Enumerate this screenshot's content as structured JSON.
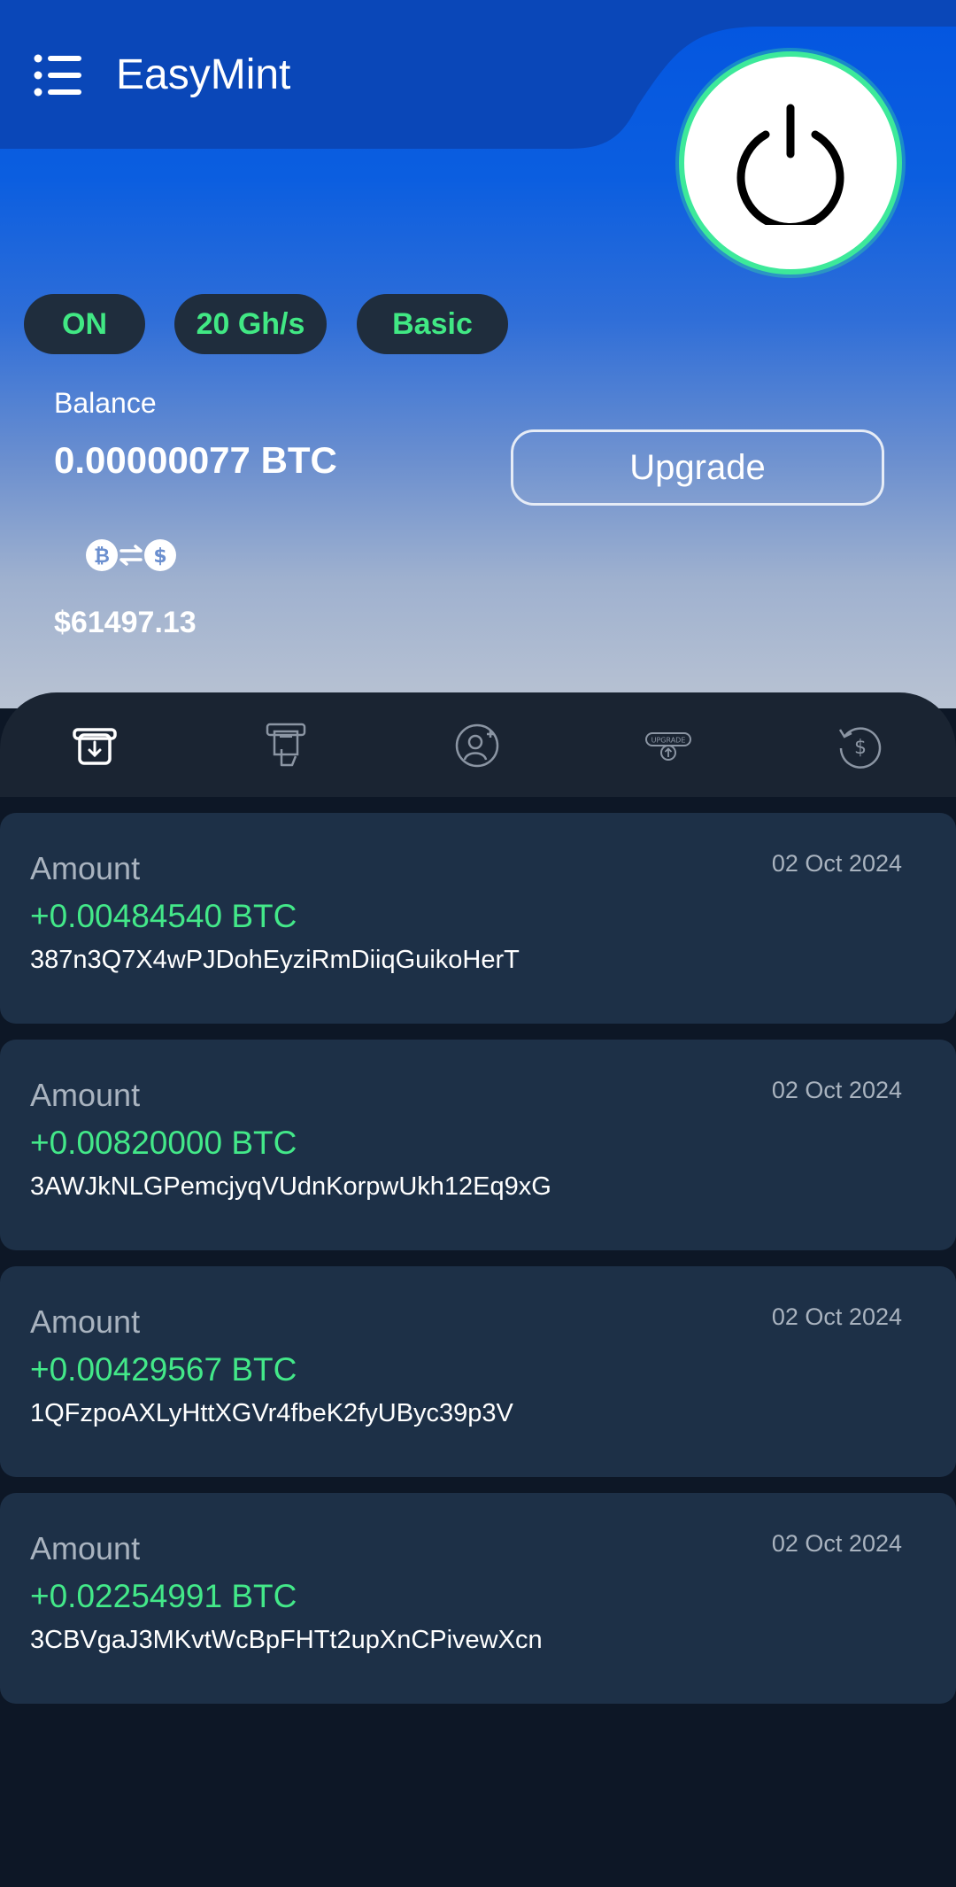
{
  "app": {
    "title": "EasyMint"
  },
  "status_chips": [
    {
      "label": "ON"
    },
    {
      "label": "20 Gh/s"
    },
    {
      "label": "Basic"
    }
  ],
  "balance": {
    "label": "Balance",
    "btc": "0.00000077 BTC",
    "usd": "$61497.13"
  },
  "upgrade_label": "Upgrade",
  "colors": {
    "accent_green": "#43e889",
    "card_bg": "#1d3047",
    "page_bg": "#0d1726",
    "power_ring": "#3de99a"
  },
  "tabs": [
    {
      "icon": "withdraw-icon",
      "active": true
    },
    {
      "icon": "atm-icon",
      "active": false
    },
    {
      "icon": "referral-icon",
      "active": false
    },
    {
      "icon": "upgrade-icon",
      "active": false
    },
    {
      "icon": "history-icon",
      "active": false
    }
  ],
  "transactions": [
    {
      "label": "Amount",
      "date": "02 Oct 2024",
      "amount": "+0.00484540 BTC",
      "address": "387n3Q7X4wPJDohEyziRmDiiqGuikoHerT"
    },
    {
      "label": "Amount",
      "date": "02 Oct 2024",
      "amount": "+0.00820000 BTC",
      "address": "3AWJkNLGPemcjyqVUdnKorpwUkh12Eq9xG"
    },
    {
      "label": "Amount",
      "date": "02 Oct 2024",
      "amount": "+0.00429567 BTC",
      "address": "1QFzpoAXLyHttXGVr4fbeK2fyUByc39p3V"
    },
    {
      "label": "Amount",
      "date": "02 Oct 2024",
      "amount": "+0.02254991 BTC",
      "address": "3CBVgaJ3MKvtWcBpFHTt2upXnCPivewXcn"
    }
  ]
}
